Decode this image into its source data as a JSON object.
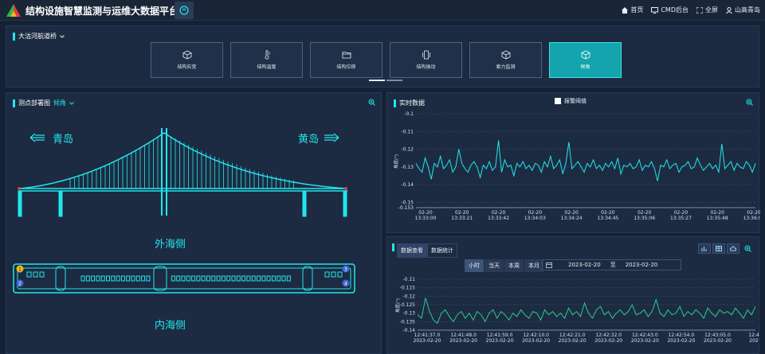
{
  "app": {
    "title": "结构设施智慧监测与运维大数据平台"
  },
  "nav": {
    "home": "首页",
    "cmd": "CMD后台",
    "fullscreen": "全屏",
    "user": "山高青岛"
  },
  "bridge_selector": "大沽河航道桥",
  "tiles": [
    {
      "label": "结构应变",
      "icon": "cube-sensor-icon",
      "active": false
    },
    {
      "label": "结构温度",
      "icon": "thermometer-icon",
      "active": false
    },
    {
      "label": "结构位移",
      "icon": "folder-icon",
      "active": false
    },
    {
      "label": "结构振动",
      "icon": "vibration-icon",
      "active": false
    },
    {
      "label": "索力监测",
      "icon": "cube-icon",
      "active": false
    },
    {
      "label": "倾角",
      "icon": "cube-active-icon",
      "active": true
    }
  ],
  "layout_panel": {
    "title": "测点部署图",
    "filter": "倾角"
  },
  "bridge": {
    "left_city": "青岛",
    "right_city": "黄岛",
    "outer_side": "外海侧",
    "inner_side": "内海侧",
    "markers": [
      "1",
      "2",
      "3",
      "4"
    ]
  },
  "realtime": {
    "title": "实时数据",
    "legend": "报警阈值",
    "ylabel": "角度(°)",
    "yticks": [
      "-0.1",
      "-0.11",
      "-0.12",
      "-0.13",
      "-0.14",
      "-0.15",
      "-0.153"
    ],
    "xticks": [
      {
        "d": "02-20",
        "t": "13:33:00"
      },
      {
        "d": "02-20",
        "t": "13:33:21"
      },
      {
        "d": "02-20",
        "t": "13:33:42"
      },
      {
        "d": "02-20",
        "t": "13:34:03"
      },
      {
        "d": "02-20",
        "t": "13:34:24"
      },
      {
        "d": "02-20",
        "t": "13:34:45"
      },
      {
        "d": "02-20",
        "t": "13:35:06"
      },
      {
        "d": "02-20",
        "t": "13:35:27"
      },
      {
        "d": "02-20",
        "t": "13:35:48"
      },
      {
        "d": "02-20",
        "t": "13:36:09"
      }
    ]
  },
  "stats": {
    "tabs": [
      "数据查看",
      "数据统计"
    ],
    "periods": [
      "小时",
      "当天",
      "本周",
      "本月"
    ],
    "date_from": "2023-02-20",
    "date_sep": "至",
    "date_to": "2023-02-20",
    "ylabel": "角度(°)",
    "yticks": [
      "-0.11",
      "-0.115",
      "-0.12",
      "-0.125",
      "-0.13",
      "-0.135",
      "-0.14"
    ],
    "xticks": [
      {
        "t": "12:41:37.0",
        "d": "2023-02-20"
      },
      {
        "t": "12:41:48.0",
        "d": "2023-02-20"
      },
      {
        "t": "12:41:59.0",
        "d": "2023-02-20"
      },
      {
        "t": "12:42:10.0",
        "d": "2023-02-20"
      },
      {
        "t": "12:42:21.0",
        "d": "2023-02-20"
      },
      {
        "t": "12:42:32.0",
        "d": "2023-02-20"
      },
      {
        "t": "12:42:43.0",
        "d": "2023-02-20"
      },
      {
        "t": "12:42:54.0",
        "d": "2023-02-20"
      },
      {
        "t": "12:43:05.0",
        "d": "2023-02-20"
      },
      {
        "t": "12:4",
        "d": "202"
      }
    ]
  },
  "chart_data": [
    {
      "type": "line",
      "ylabel": "角度(°)",
      "ylim": [
        -0.153,
        -0.1
      ],
      "x": [
        "13:33:00",
        "13:33:21",
        "13:33:42",
        "13:34:03",
        "13:34:24",
        "13:34:45",
        "13:35:06",
        "13:35:27",
        "13:35:48",
        "13:36:09"
      ],
      "values": [
        -0.128,
        -0.131,
        -0.133,
        -0.125,
        -0.13,
        -0.137,
        -0.128,
        -0.13,
        -0.124,
        -0.131,
        -0.129,
        -0.126,
        -0.133,
        -0.13,
        -0.12,
        -0.128,
        -0.131,
        -0.133,
        -0.129,
        -0.127,
        -0.13,
        -0.136,
        -0.129,
        -0.131,
        -0.127,
        -0.132,
        -0.13,
        -0.115,
        -0.133,
        -0.126,
        -0.13,
        -0.129,
        -0.135,
        -0.128,
        -0.13,
        -0.127,
        -0.131,
        -0.129,
        -0.132,
        -0.128,
        -0.129,
        -0.133,
        -0.127,
        -0.13,
        -0.124,
        -0.131,
        -0.129,
        -0.126,
        -0.134,
        -0.128,
        -0.116,
        -0.131,
        -0.129,
        -0.127,
        -0.13,
        -0.133,
        -0.128,
        -0.13,
        -0.126,
        -0.131,
        -0.129,
        -0.132,
        -0.128,
        -0.13,
        -0.127,
        -0.131,
        -0.125,
        -0.134,
        -0.129,
        -0.13,
        -0.128,
        -0.131,
        -0.13,
        -0.126,
        -0.132,
        -0.129,
        -0.13,
        -0.127,
        -0.131,
        -0.138,
        -0.129,
        -0.13,
        -0.126,
        -0.131,
        -0.129,
        -0.128,
        -0.133,
        -0.13,
        -0.129,
        -0.127,
        -0.131,
        -0.13,
        -0.125,
        -0.129,
        -0.132,
        -0.13,
        -0.128,
        -0.131,
        -0.129,
        -0.133,
        -0.117,
        -0.131,
        -0.129,
        -0.127,
        -0.132,
        -0.128,
        -0.13,
        -0.131,
        -0.127,
        -0.129,
        -0.133,
        -0.128
      ]
    },
    {
      "type": "line",
      "ylabel": "角度(°)",
      "ylim": [
        -0.14,
        -0.11
      ],
      "x": [
        "12:41:37.0",
        "12:41:48.0",
        "12:41:59.0",
        "12:42:10.0",
        "12:42:21.0",
        "12:42:32.0",
        "12:42:43.0",
        "12:42:54.0",
        "12:43:05.0"
      ],
      "values": [
        -0.131,
        -0.133,
        -0.121,
        -0.129,
        -0.134,
        -0.136,
        -0.13,
        -0.128,
        -0.132,
        -0.135,
        -0.131,
        -0.129,
        -0.133,
        -0.13,
        -0.134,
        -0.129,
        -0.131,
        -0.135,
        -0.13,
        -0.128,
        -0.133,
        -0.129,
        -0.131,
        -0.134,
        -0.13,
        -0.132,
        -0.128,
        -0.131,
        -0.133,
        -0.129,
        -0.13,
        -0.134,
        -0.128,
        -0.131,
        -0.129,
        -0.132,
        -0.13,
        -0.133,
        -0.127,
        -0.131,
        -0.129,
        -0.132,
        -0.124,
        -0.13,
        -0.133,
        -0.128,
        -0.126,
        -0.131,
        -0.129,
        -0.133,
        -0.13,
        -0.128,
        -0.131,
        -0.129,
        -0.125,
        -0.131,
        -0.13,
        -0.128,
        -0.132,
        -0.129,
        -0.122,
        -0.13,
        -0.132,
        -0.128,
        -0.131,
        -0.13,
        -0.126,
        -0.132,
        -0.129,
        -0.131,
        -0.128,
        -0.13,
        -0.133,
        -0.127,
        -0.13,
        -0.132,
        -0.128,
        -0.13,
        -0.129,
        -0.131,
        -0.127,
        -0.13,
        -0.133,
        -0.128,
        -0.131,
        -0.126
      ]
    }
  ]
}
